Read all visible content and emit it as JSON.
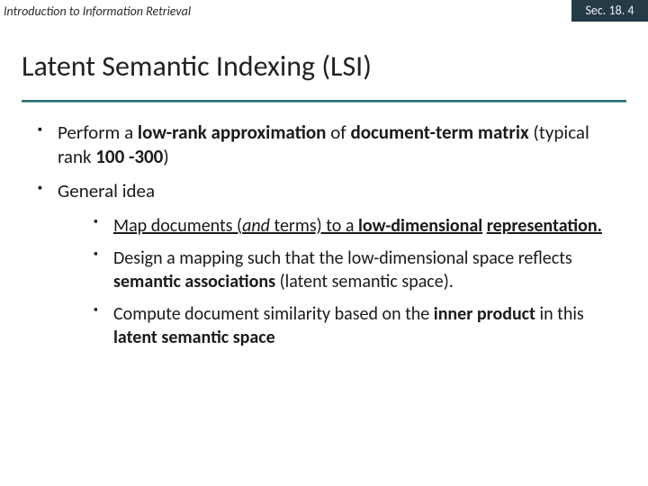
{
  "header": {
    "left": "Introduction to Information Retrieval",
    "right": "Sec. 18. 4"
  },
  "title": "Latent Semantic Indexing (LSI)",
  "bullets": {
    "b1": {
      "t1": "Perform a ",
      "t2": "low-rank approximation",
      "t3": " of ",
      "t4": "document-term matrix",
      "t5": " (typical rank ",
      "t6": "100 -300",
      "t7": ")"
    },
    "b2": "General idea",
    "sub": {
      "s1": {
        "t1": "Map documents (",
        "t2": "and",
        "t3": " terms) to a ",
        "t4": "low-dimensional",
        "t5": " ",
        "t6": "representation."
      },
      "s2": {
        "t1": "Design a mapping such that the low-dimensional space reflects ",
        "t2": "semantic associations",
        "t3": " (latent semantic space)."
      },
      "s3": {
        "t1": "Compute document similarity based on the ",
        "t2": "inner product",
        "t3": " in this ",
        "t4": "latent semantic space"
      }
    }
  }
}
